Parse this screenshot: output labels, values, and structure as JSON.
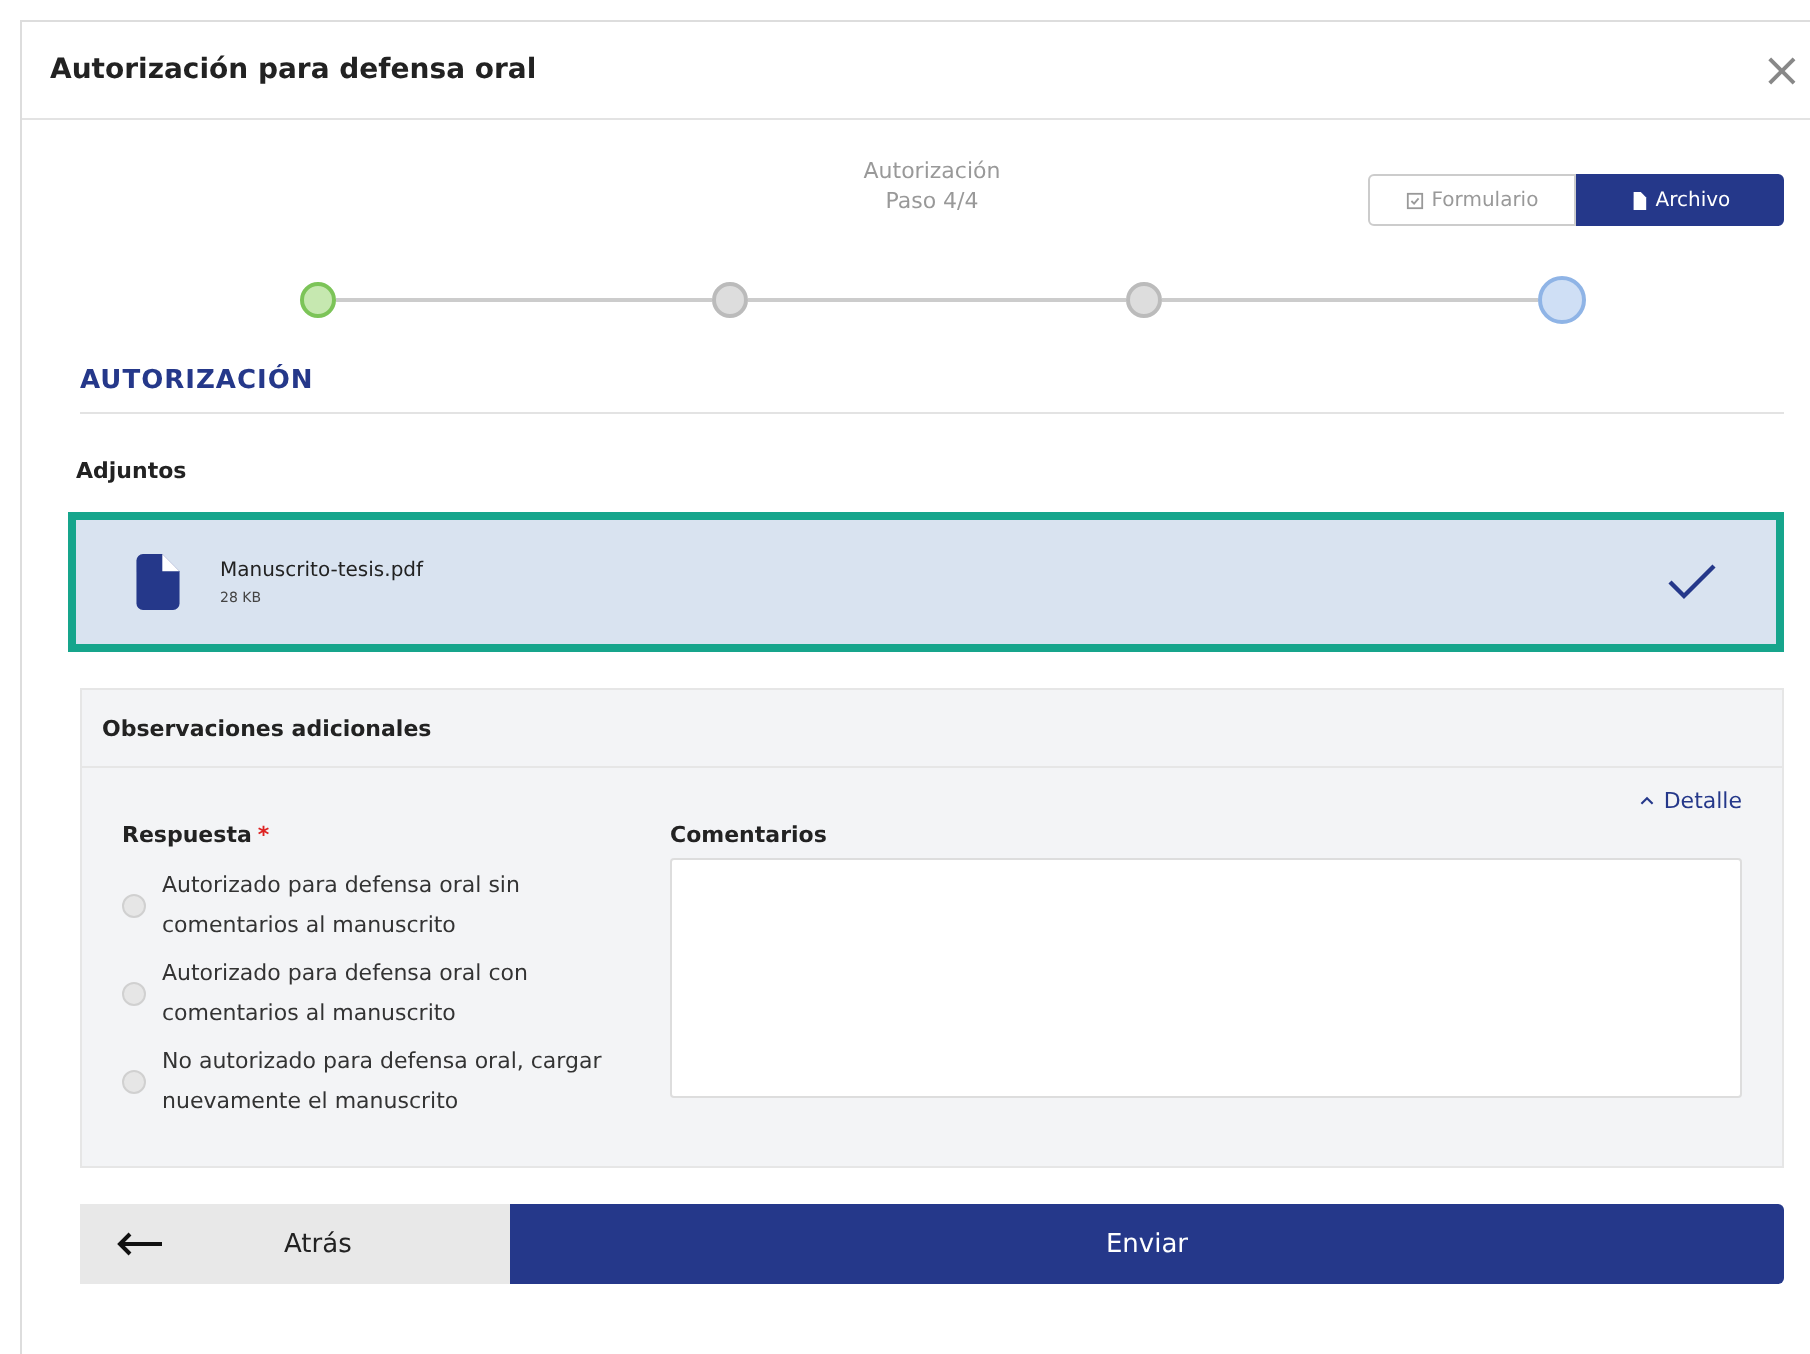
{
  "dialog": {
    "title": "Autorización para defensa oral",
    "close": "×"
  },
  "step_label": {
    "title": "Autorización",
    "progress": "Paso 4/4"
  },
  "view_toggle": [
    {
      "label": "Formulario",
      "selected": false
    },
    {
      "label": "Archivo",
      "selected": true
    }
  ],
  "steps": [
    {
      "done": true,
      "selected": false
    },
    {
      "done": false,
      "selected": false
    },
    {
      "done": false,
      "selected": false
    },
    {
      "done": false,
      "selected": true
    }
  ],
  "section_title": "AUTORIZACIÓN",
  "attachments": {
    "label": "Adjuntos",
    "files": [
      {
        "name": "Manuscrito-tesis.pdf",
        "size": "28 KB",
        "selected": true
      }
    ]
  },
  "observations": {
    "title": "Observaciones adicionales",
    "detail_link": "Detalle",
    "expanded": true,
    "response": {
      "label": "Respuesta",
      "required_mark": "*",
      "options": [
        {
          "label": "Autorizado para defensa oral sin comentarios al manuscrito",
          "selected": false
        },
        {
          "label": "Autorizado para defensa oral con comentarios al manuscrito",
          "selected": false
        },
        {
          "label": "No autorizado para defensa oral, cargar nuevamente el manuscrito",
          "selected": false
        }
      ]
    },
    "comments": {
      "label": "Comentarios"
    }
  },
  "buttons": {
    "back": "Atrás",
    "submit": "Enviar"
  }
}
